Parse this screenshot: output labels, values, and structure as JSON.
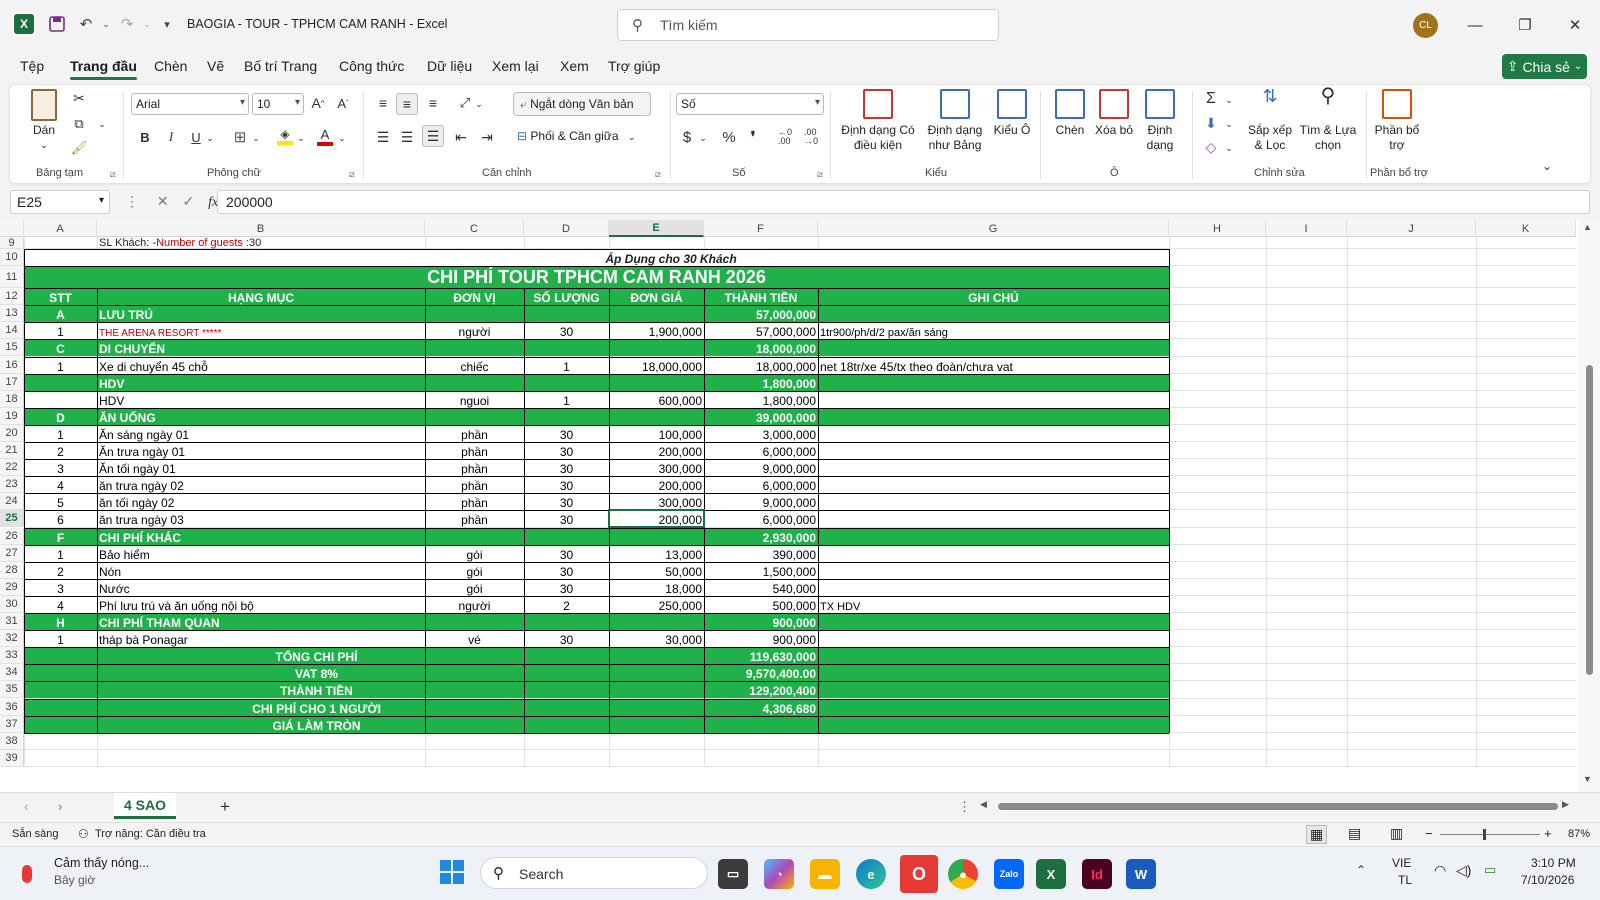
{
  "window": {
    "title": "BAOGIA - TOUR - TPHCM CAM RANH  -  Excel",
    "search_placeholder": "Tìm kiếm",
    "avatar_initials": "CL",
    "share_label": "Chia sẻ"
  },
  "menu": [
    "Tệp",
    "Trang đầu",
    "Chèn",
    "Vẽ",
    "Bố trí Trang",
    "Công thức",
    "Dữ liệu",
    "Xem lại",
    "Xem",
    "Trợ giúp"
  ],
  "ribbon": {
    "clipboard": {
      "paste": "Dán",
      "label": "Bảng tạm"
    },
    "font": {
      "name": "Arial",
      "size": "10",
      "label": "Phông chữ",
      "bold": "B",
      "italic": "I",
      "underline": "U"
    },
    "alignment": {
      "wrap": "Ngắt dòng Văn bản",
      "merge": "Phối & Căn giữa",
      "label": "Căn chỉnh"
    },
    "number": {
      "format": "Số",
      "label": "Số"
    },
    "styles": {
      "conditional": "Định dạng Có điều kiện",
      "table": "Định dạng như Bảng",
      "cell": "Kiểu Ô",
      "label": "Kiểu"
    },
    "cells": {
      "insert": "Chèn",
      "delete": "Xóa bỏ",
      "format": "Định dạng",
      "label": "Ô"
    },
    "editing": {
      "sort": "Sắp xếp & Lọc",
      "find": "Tìm & Lựa chọn",
      "label": "Chỉnh sửa"
    },
    "addins": {
      "label": "Phần bổ trợ",
      "button": "Phần bổ trợ"
    }
  },
  "formula_bar": {
    "name_box": "E25",
    "value": "200000"
  },
  "columns": [
    "A",
    "B",
    "C",
    "D",
    "E",
    "F",
    "G",
    "H",
    "I",
    "J",
    "K"
  ],
  "rows": [
    "9",
    "10",
    "11",
    "12",
    "13",
    "14",
    "15",
    "16",
    "17",
    "18",
    "19",
    "20",
    "21",
    "22",
    "23",
    "24",
    "25",
    "26",
    "27",
    "28",
    "29",
    "30",
    "31",
    "32",
    "33",
    "34",
    "35",
    "36",
    "37",
    "38",
    "39"
  ],
  "sheet": {
    "row9_b": "SL Khách: - ",
    "row9_b_red": "Number of guests :",
    "row9_b_num": "30",
    "subtitle": "Áp Dụng cho 30 Khách",
    "title": "CHI PHÍ TOUR TPHCM CAM RANH   2026",
    "headers": [
      "STT",
      "HẠNG MỤC",
      "ĐƠN VỊ",
      "SỐ LƯỢNG",
      "ĐƠN GIÁ",
      "THÀNH TIỀN",
      "GHI CHÚ"
    ],
    "body": [
      {
        "r": "13",
        "kind": "green",
        "a": "A",
        "b": "LƯU TRÚ",
        "f": "57,000,000"
      },
      {
        "r": "14",
        "kind": "white",
        "a": "1",
        "b": "THE ARENA RESORT *****",
        "b_red": true,
        "c": "người",
        "d": "30",
        "e": "1,900,000",
        "f": "57,000,000",
        "g": "1tr900/ph/d/2 pax/ăn sáng"
      },
      {
        "r": "15",
        "kind": "green",
        "a": "C",
        "b": "DI CHUYỂN",
        "f": "18,000,000"
      },
      {
        "r": "16",
        "kind": "white",
        "a": "1",
        "b": "Xe di chuyển 45 chỗ",
        "c": "chiếc",
        "d": "1",
        "e": "18,000,000",
        "f": "18,000,000",
        "g": "net 18tr/xe 45/tx theo đoàn/chưa vat"
      },
      {
        "r": "17",
        "kind": "green",
        "a": "",
        "b": "HDV",
        "f": "1,800,000"
      },
      {
        "r": "18",
        "kind": "white",
        "a": "",
        "b": "HDV",
        "c": "nguoi",
        "d": "1",
        "e": "600,000",
        "f": "1,800,000"
      },
      {
        "r": "19",
        "kind": "green",
        "a": "D",
        "b": "ĂN UỐNG",
        "f": "39,000,000"
      },
      {
        "r": "20",
        "kind": "white",
        "a": "1",
        "b": "Ăn sáng ngày 01",
        "c": "phần",
        "d": "30",
        "e": "100,000",
        "f": "3,000,000"
      },
      {
        "r": "21",
        "kind": "white",
        "a": "2",
        "b": "Ăn trưa ngày 01",
        "c": "phần",
        "d": "30",
        "e": "200,000",
        "f": "6,000,000"
      },
      {
        "r": "22",
        "kind": "white",
        "a": "3",
        "b": "Ăn tối ngày 01",
        "c": "phần",
        "d": "30",
        "e": "300,000",
        "f": "9,000,000"
      },
      {
        "r": "23",
        "kind": "white",
        "a": "4",
        "b": "ăn trưa ngày  02",
        "c": "phần",
        "d": "30",
        "e": "200,000",
        "f": "6,000,000"
      },
      {
        "r": "24",
        "kind": "white",
        "a": "5",
        "b": "ăn tối ngày  02",
        "c": "phần",
        "d": "30",
        "e": "300,000",
        "f": "9,000,000"
      },
      {
        "r": "25",
        "kind": "white",
        "a": "6",
        "b": "ăn trưa ngày  03",
        "c": "phần",
        "d": "30",
        "e": "200,000",
        "f": "6,000,000"
      },
      {
        "r": "26",
        "kind": "green",
        "a": "F",
        "b": "CHI PHÍ KHÁC",
        "f": "2,930,000"
      },
      {
        "r": "27",
        "kind": "white",
        "a": "1",
        "b": "Bảo hiểm",
        "c": "gói",
        "d": "30",
        "e": "13,000",
        "f": "390,000"
      },
      {
        "r": "28",
        "kind": "white",
        "a": "2",
        "b": "Nón",
        "c": "gói",
        "d": "30",
        "e": "50,000",
        "f": "1,500,000"
      },
      {
        "r": "29",
        "kind": "white",
        "a": "3",
        "b": "Nước",
        "c": "gói",
        "d": "30",
        "e": "18,000",
        "f": "540,000"
      },
      {
        "r": "30",
        "kind": "white",
        "a": "4",
        "b": "Phí lưu trú và ăn uống nội bộ",
        "c": "người",
        "d": "2",
        "e": "250,000",
        "f": "500,000",
        "g": "TX HDV"
      },
      {
        "r": "31",
        "kind": "green",
        "a": "H",
        "b": "CHI PHÍ THAM QUAN",
        "f": "900,000"
      },
      {
        "r": "32",
        "kind": "white",
        "a": "1",
        "b": "tháp bà Ponagar",
        "c": "vé",
        "d": "30",
        "e": "30,000",
        "f": "900,000"
      }
    ],
    "totals": [
      {
        "r": "33",
        "label": "TỔNG CHI PHÍ",
        "f": "119,630,000"
      },
      {
        "r": "34",
        "label": "VAT 8%",
        "f": "9,570,400.00"
      },
      {
        "r": "35",
        "label": "THÀNH TIỀN",
        "f": "129,200,400"
      },
      {
        "r": "36",
        "label": "CHI PHÍ CHO 1 NGƯỜI",
        "f": "4,306,680"
      },
      {
        "r": "37",
        "label": "GIÁ LÀM TRÒN",
        "f": ""
      }
    ]
  },
  "sheet_tab": "4 SAO",
  "status": {
    "ready": "Sẵn sàng",
    "accessibility": "Trợ năng: Cần điều tra",
    "zoom": "87%"
  },
  "taskbar": {
    "weather_title": "Cảm thấy nóng...",
    "weather_sub": "Bây giờ",
    "search": "Search",
    "lang1": "VIE",
    "lang2": "TL",
    "time": "3:10 PM",
    "date": "7/10/2026"
  },
  "colors": {
    "green": "#21b14b",
    "excel": "#1d6f42",
    "red_text": "#c00000"
  }
}
